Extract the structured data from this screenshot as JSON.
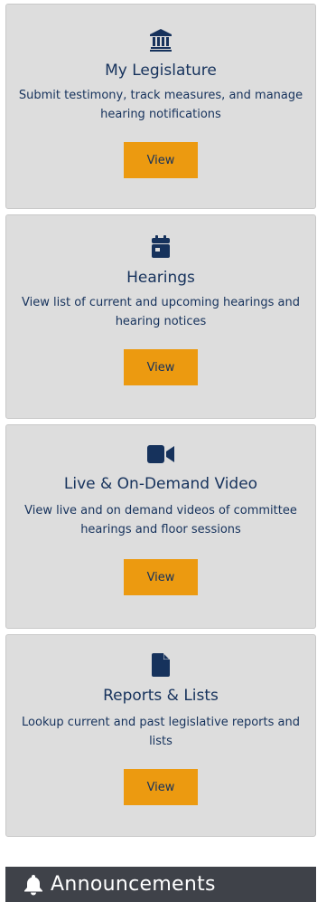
{
  "cards": [
    {
      "icon": "building-columns-icon",
      "title": "My Legislature",
      "description": "Submit testimony, track measures, and manage hearing notifications",
      "button_label": "View"
    },
    {
      "icon": "calendar-icon",
      "title": "Hearings",
      "description": "View list of current and upcoming hearings and hearing notices",
      "button_label": "View"
    },
    {
      "icon": "video-camera-icon",
      "title": "Live & On-Demand Video",
      "description": "View live and on demand videos of committee hearings and floor sessions",
      "button_label": "View"
    },
    {
      "icon": "file-icon",
      "title": "Reports & Lists",
      "description": "Lookup current and past legislative reports and lists",
      "button_label": "View"
    }
  ],
  "announcements": {
    "icon": "bell-icon",
    "label": "Announcements"
  },
  "colors": {
    "card_background": "#dddddd",
    "text": "#16325c",
    "button": "#ec9a10",
    "announcements_bar": "#3f4249"
  }
}
